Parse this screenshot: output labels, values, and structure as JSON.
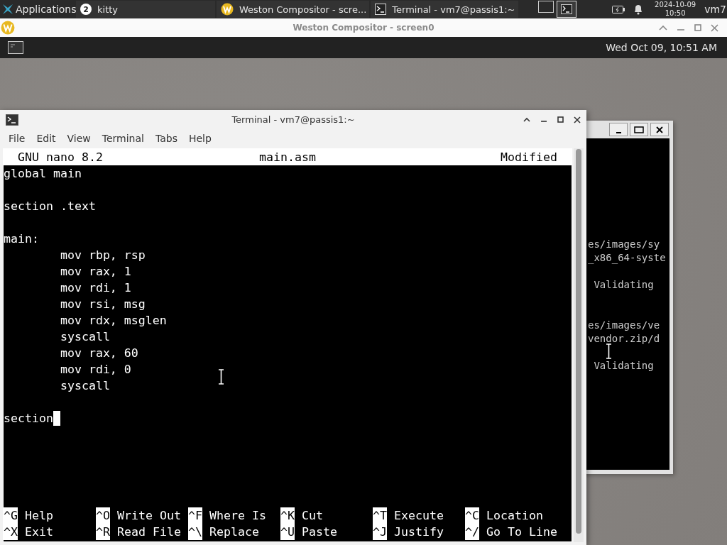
{
  "top_panel": {
    "apps_menu": "Applications",
    "tasks": [
      {
        "kind": "kitty",
        "title": "kitty",
        "badge": "2"
      },
      {
        "kind": "weston",
        "title": "Weston Compositor - scre..."
      },
      {
        "kind": "terminal",
        "title": "Terminal - vm7@passis1:~"
      }
    ],
    "workspaces": [
      {
        "selected": false
      },
      {
        "selected": true
      }
    ],
    "date": "2024-10-09",
    "time": "10:50",
    "user": "vm7"
  },
  "weston_window": {
    "title": "Weston Compositor - screen0",
    "clock": "Wed Oct 09, 10:51 AM"
  },
  "back_window": {
    "lines": [
      {
        "kind": "text",
        "text": "es/images/sy"
      },
      {
        "kind": "text",
        "text": "_x86_64-syste"
      },
      {
        "kind": "blank"
      },
      {
        "kind": "text",
        "text": " Validating"
      },
      {
        "kind": "blank"
      },
      {
        "kind": "blank"
      },
      {
        "kind": "text",
        "text": "es/images/ve"
      },
      {
        "kind": "text",
        "text": "vendor.zip/d"
      },
      {
        "kind": "blank"
      },
      {
        "kind": "text",
        "text": " Validating"
      }
    ]
  },
  "terminal_window": {
    "title": "Terminal - vm7@passis1:~",
    "menu": [
      "File",
      "Edit",
      "View",
      "Terminal",
      "Tabs",
      "Help"
    ],
    "nano": {
      "version": "GNU nano 8.2",
      "filename": "main.asm",
      "status": "Modified",
      "lines": [
        {
          "text": "global main",
          "cursor": false
        },
        {
          "cursor": false
        },
        {
          "text": "section .text",
          "cursor": false
        },
        {
          "cursor": false
        },
        {
          "text": "main:",
          "cursor": false
        },
        {
          "text": "\tmov rbp, rsp",
          "cursor": false
        },
        {
          "text": "\tmov rax, 1",
          "cursor": false
        },
        {
          "text": "\tmov rdi, 1",
          "cursor": false
        },
        {
          "text": "\tmov rsi, msg",
          "cursor": false
        },
        {
          "text": "\tmov rdx, msglen",
          "cursor": false
        },
        {
          "text": "\tsyscall",
          "cursor": false
        },
        {
          "text": "\tmov rax, 60",
          "cursor": false
        },
        {
          "text": "\tmov rdi, 0",
          "cursor": false
        },
        {
          "text": "\tsyscall",
          "cursor": false
        },
        {
          "cursor": false
        },
        {
          "text": "section",
          "cursor": true
        }
      ],
      "shortcuts": [
        [
          {
            "key": "^G",
            "label": "Help"
          },
          {
            "key": "^X",
            "label": "Exit"
          }
        ],
        [
          {
            "key": "^O",
            "label": "Write Out"
          },
          {
            "key": "^R",
            "label": "Read File"
          }
        ],
        [
          {
            "key": "^F",
            "label": "Where Is"
          },
          {
            "key": "^\\",
            "label": "Replace"
          }
        ],
        [
          {
            "key": "^K",
            "label": "Cut"
          },
          {
            "key": "^U",
            "label": "Paste"
          }
        ],
        [
          {
            "key": "^T",
            "label": "Execute"
          },
          {
            "key": "^J",
            "label": "Justify"
          }
        ],
        [
          {
            "key": "^C",
            "label": "Location"
          },
          {
            "key": "^/",
            "label": "Go To Line"
          }
        ]
      ]
    }
  }
}
